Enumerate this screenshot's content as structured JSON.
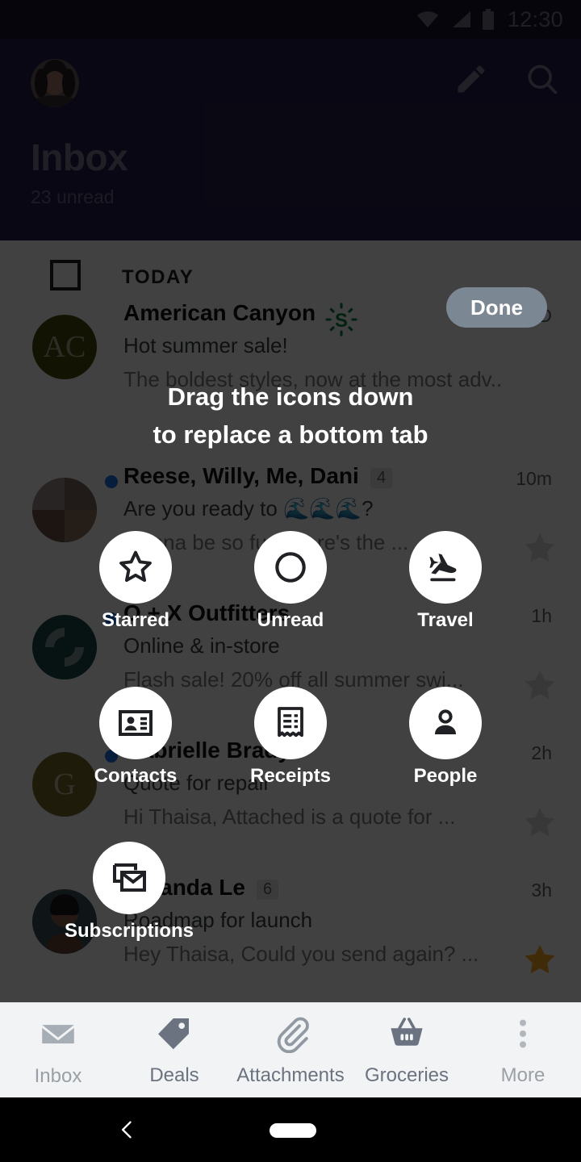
{
  "status_bar": {
    "time": "12:30",
    "icons": [
      "wifi-icon",
      "cellular-signal-icon",
      "battery-icon"
    ]
  },
  "header": {
    "title": "Inbox",
    "unread_label": "23 unread",
    "avatar_name": "user-avatar",
    "compose_icon": "compose-pencil-icon",
    "search_icon": "search-icon",
    "background_color": "#251d4b"
  },
  "list": {
    "section_label": "TODAY",
    "select_all_checkbox": "unchecked",
    "emails": [
      {
        "sender": "American Canyon",
        "subject": "Hot summer sale!",
        "snippet": "The boldest styles, now at the most adv...",
        "time": "AD",
        "is_ad": true,
        "unread": false,
        "starred": false,
        "count": "",
        "avatar_initials": "AC",
        "avatar_color": "#4a4a12",
        "badge_icon": "sponsored-dollar-icon"
      },
      {
        "sender": "Reese, Willy, Me, Dani",
        "subject": "Are you ready to 🌊🌊🌊?",
        "snippet": "Gonna be so fun. Here's the ...",
        "time": "10m",
        "is_ad": false,
        "unread": true,
        "starred": false,
        "count": "4",
        "avatar_initials": "",
        "avatar_color": "#6b5a52"
      },
      {
        "sender": "O + X Outfitters",
        "subject": "Online & in-store",
        "snippet": "Flash sale! 20% off all summer swi...",
        "time": "1h",
        "is_ad": false,
        "unread": true,
        "starred": false,
        "count": "",
        "avatar_initials": "",
        "avatar_color": "#1b4a47"
      },
      {
        "sender": "Gabrielle Brady",
        "subject": "Quote for repair",
        "snippet": "Hi Thaisa, Attached is a quote for ...",
        "time": "2h",
        "is_ad": false,
        "unread": true,
        "starred": false,
        "count": "",
        "avatar_initials": "G",
        "avatar_color": "#7a6a28"
      },
      {
        "sender": "Amanda Le",
        "subject": "Roadmap for launch",
        "snippet": "Hey Thaisa, Could you send again? ...",
        "time": "3h",
        "is_ad": false,
        "unread": false,
        "starred": true,
        "count": "6",
        "avatar_initials": "",
        "avatar_color": "#3d4f58"
      }
    ]
  },
  "coach_overlay": {
    "done_label": "Done",
    "instruction_line1": "Drag the icons down",
    "instruction_line2": "to replace a bottom tab",
    "chips": [
      {
        "label": "Starred",
        "icon": "star-outline-icon"
      },
      {
        "label": "Unread",
        "icon": "circle-outline-icon"
      },
      {
        "label": "Travel",
        "icon": "airplane-icon"
      },
      {
        "label": "Contacts",
        "icon": "contact-card-icon"
      },
      {
        "label": "Receipts",
        "icon": "receipt-icon"
      },
      {
        "label": "People",
        "icon": "person-icon"
      },
      {
        "label": "Subscriptions",
        "icon": "stacked-envelope-icon"
      }
    ]
  },
  "bottom_nav": {
    "items": [
      {
        "label": "Inbox",
        "icon": "envelope-icon",
        "selected": false,
        "muted": true
      },
      {
        "label": "Deals",
        "icon": "price-tag-icon",
        "selected": false,
        "muted": false
      },
      {
        "label": "Attachments",
        "icon": "paperclip-icon",
        "selected": false,
        "muted": false
      },
      {
        "label": "Groceries",
        "icon": "basket-icon",
        "selected": false,
        "muted": false
      },
      {
        "label": "More",
        "icon": "more-dots-icon",
        "selected": false,
        "muted": true
      }
    ]
  },
  "system_nav": {
    "back_icon": "back-chevron-icon",
    "home_icon": "home-pill-icon"
  },
  "colors": {
    "header_purple": "#251d4b",
    "status_bar": "#1b1630",
    "unread_dot": "#1a73e8",
    "star_active": "#f5a623",
    "done_button": "#7c8794",
    "nav_background": "#f1f3f4"
  }
}
